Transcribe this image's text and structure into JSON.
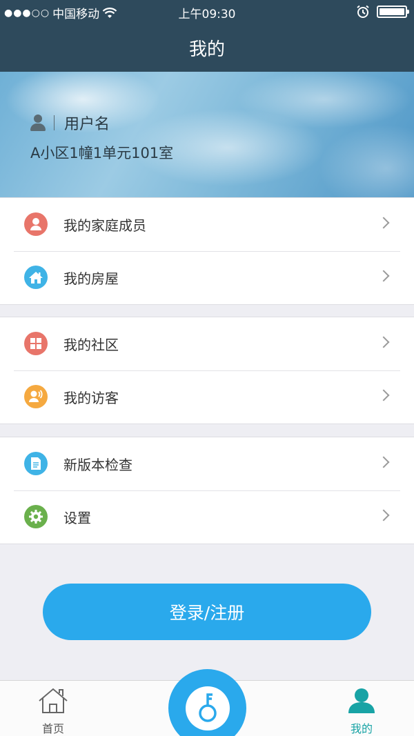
{
  "status_bar": {
    "carrier": "中国移动",
    "time": "上午09:30"
  },
  "nav": {
    "title": "我的"
  },
  "profile": {
    "username": "用户名",
    "address": "A小区1幢1单元101室"
  },
  "menu_groups": [
    {
      "items": [
        {
          "label": "我的家庭成员",
          "icon": "person-icon",
          "color": "#e8756a"
        },
        {
          "label": "我的房屋",
          "icon": "house-icon",
          "color": "#3fb3e6"
        }
      ]
    },
    {
      "items": [
        {
          "label": "我的社区",
          "icon": "grid-icon",
          "color": "#e8756a"
        },
        {
          "label": "我的访客",
          "icon": "visitor-icon",
          "color": "#f5a940"
        }
      ]
    },
    {
      "items": [
        {
          "label": "新版本检查",
          "icon": "document-icon",
          "color": "#3fb3e6"
        },
        {
          "label": "设置",
          "icon": "gear-icon",
          "color": "#6ab04c"
        }
      ]
    }
  ],
  "login_button": {
    "label": "登录/注册",
    "color": "#2aa9ec"
  },
  "tab_bar": {
    "home_label": "首页",
    "mine_label": "我的",
    "active_color": "#18a3a5"
  }
}
